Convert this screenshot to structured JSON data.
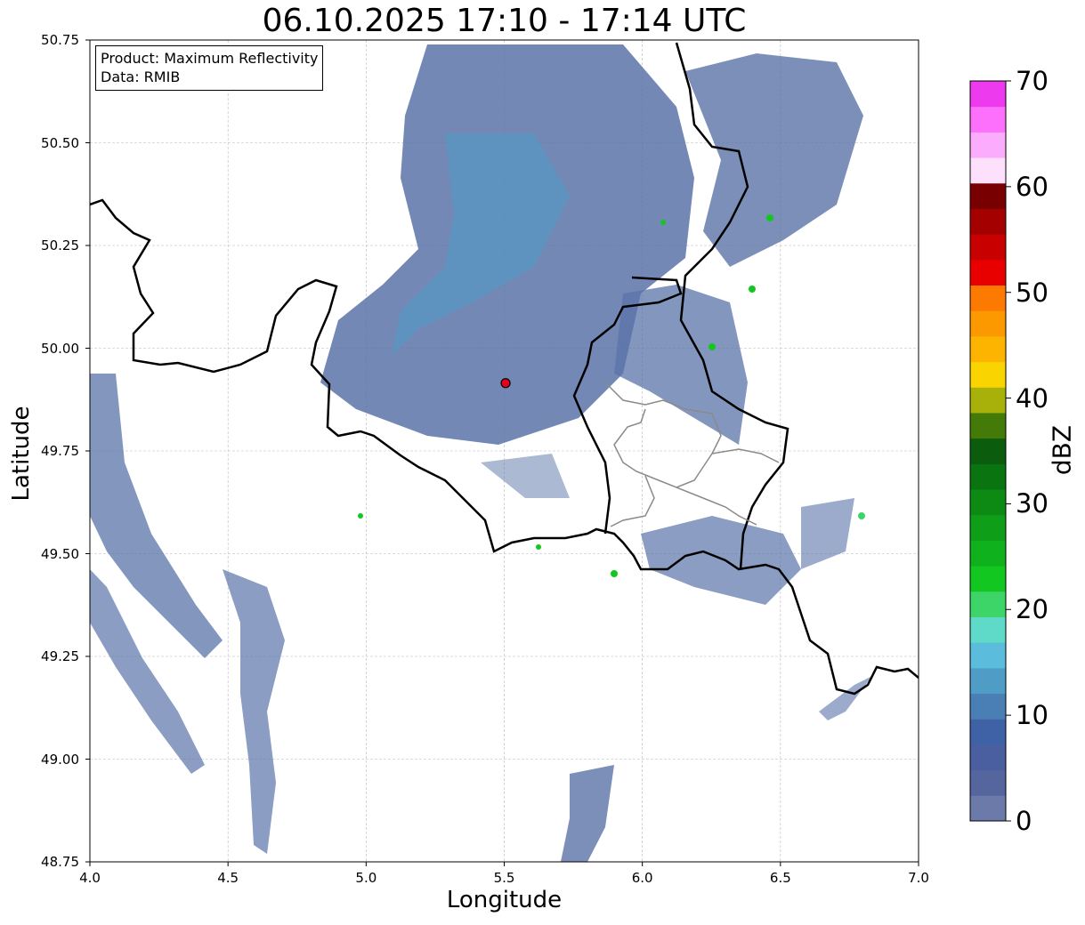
{
  "title": "06.10.2025 17:10 - 17:14 UTC",
  "info_box": {
    "product": "Product: Maximum Reflectivity",
    "data": "Data: RMIB"
  },
  "axes": {
    "xlabel": "Longitude",
    "ylabel": "Latitude",
    "x_range": [
      4.0,
      7.0
    ],
    "y_range": [
      48.75,
      50.75
    ],
    "x_ticks": [
      "4.0",
      "4.5",
      "5.0",
      "5.5",
      "6.0",
      "6.5",
      "7.0"
    ],
    "y_ticks": [
      "50.75",
      "50.50",
      "50.25",
      "50.00",
      "49.75",
      "49.50",
      "49.25",
      "49.00",
      "48.75"
    ],
    "grid": true
  },
  "radar_site": {
    "lon": 5.505,
    "lat": 49.915,
    "color": "#e8001e"
  },
  "colorbar": {
    "label": "dBZ",
    "range": [
      0,
      70
    ],
    "ticks": [
      "0",
      "10",
      "20",
      "30",
      "40",
      "50",
      "60",
      "70"
    ],
    "colors": [
      "#6b7aa8",
      "#55669e",
      "#4a5fa0",
      "#3f62a6",
      "#4a7fb5",
      "#4f9cc6",
      "#5bbcdc",
      "#5fd9c8",
      "#3dd468",
      "#12c820",
      "#0fb21c",
      "#0e9e18",
      "#0c8a14",
      "#0a7410",
      "#0b5c0c",
      "#447a08",
      "#a8b00a",
      "#fad400",
      "#fcb400",
      "#fc9800",
      "#fc7a00",
      "#e80000",
      "#c80000",
      "#a40000",
      "#780000",
      "#fce0fc",
      "#fcacfc",
      "#fc70fc",
      "#ee3aee"
    ]
  }
}
